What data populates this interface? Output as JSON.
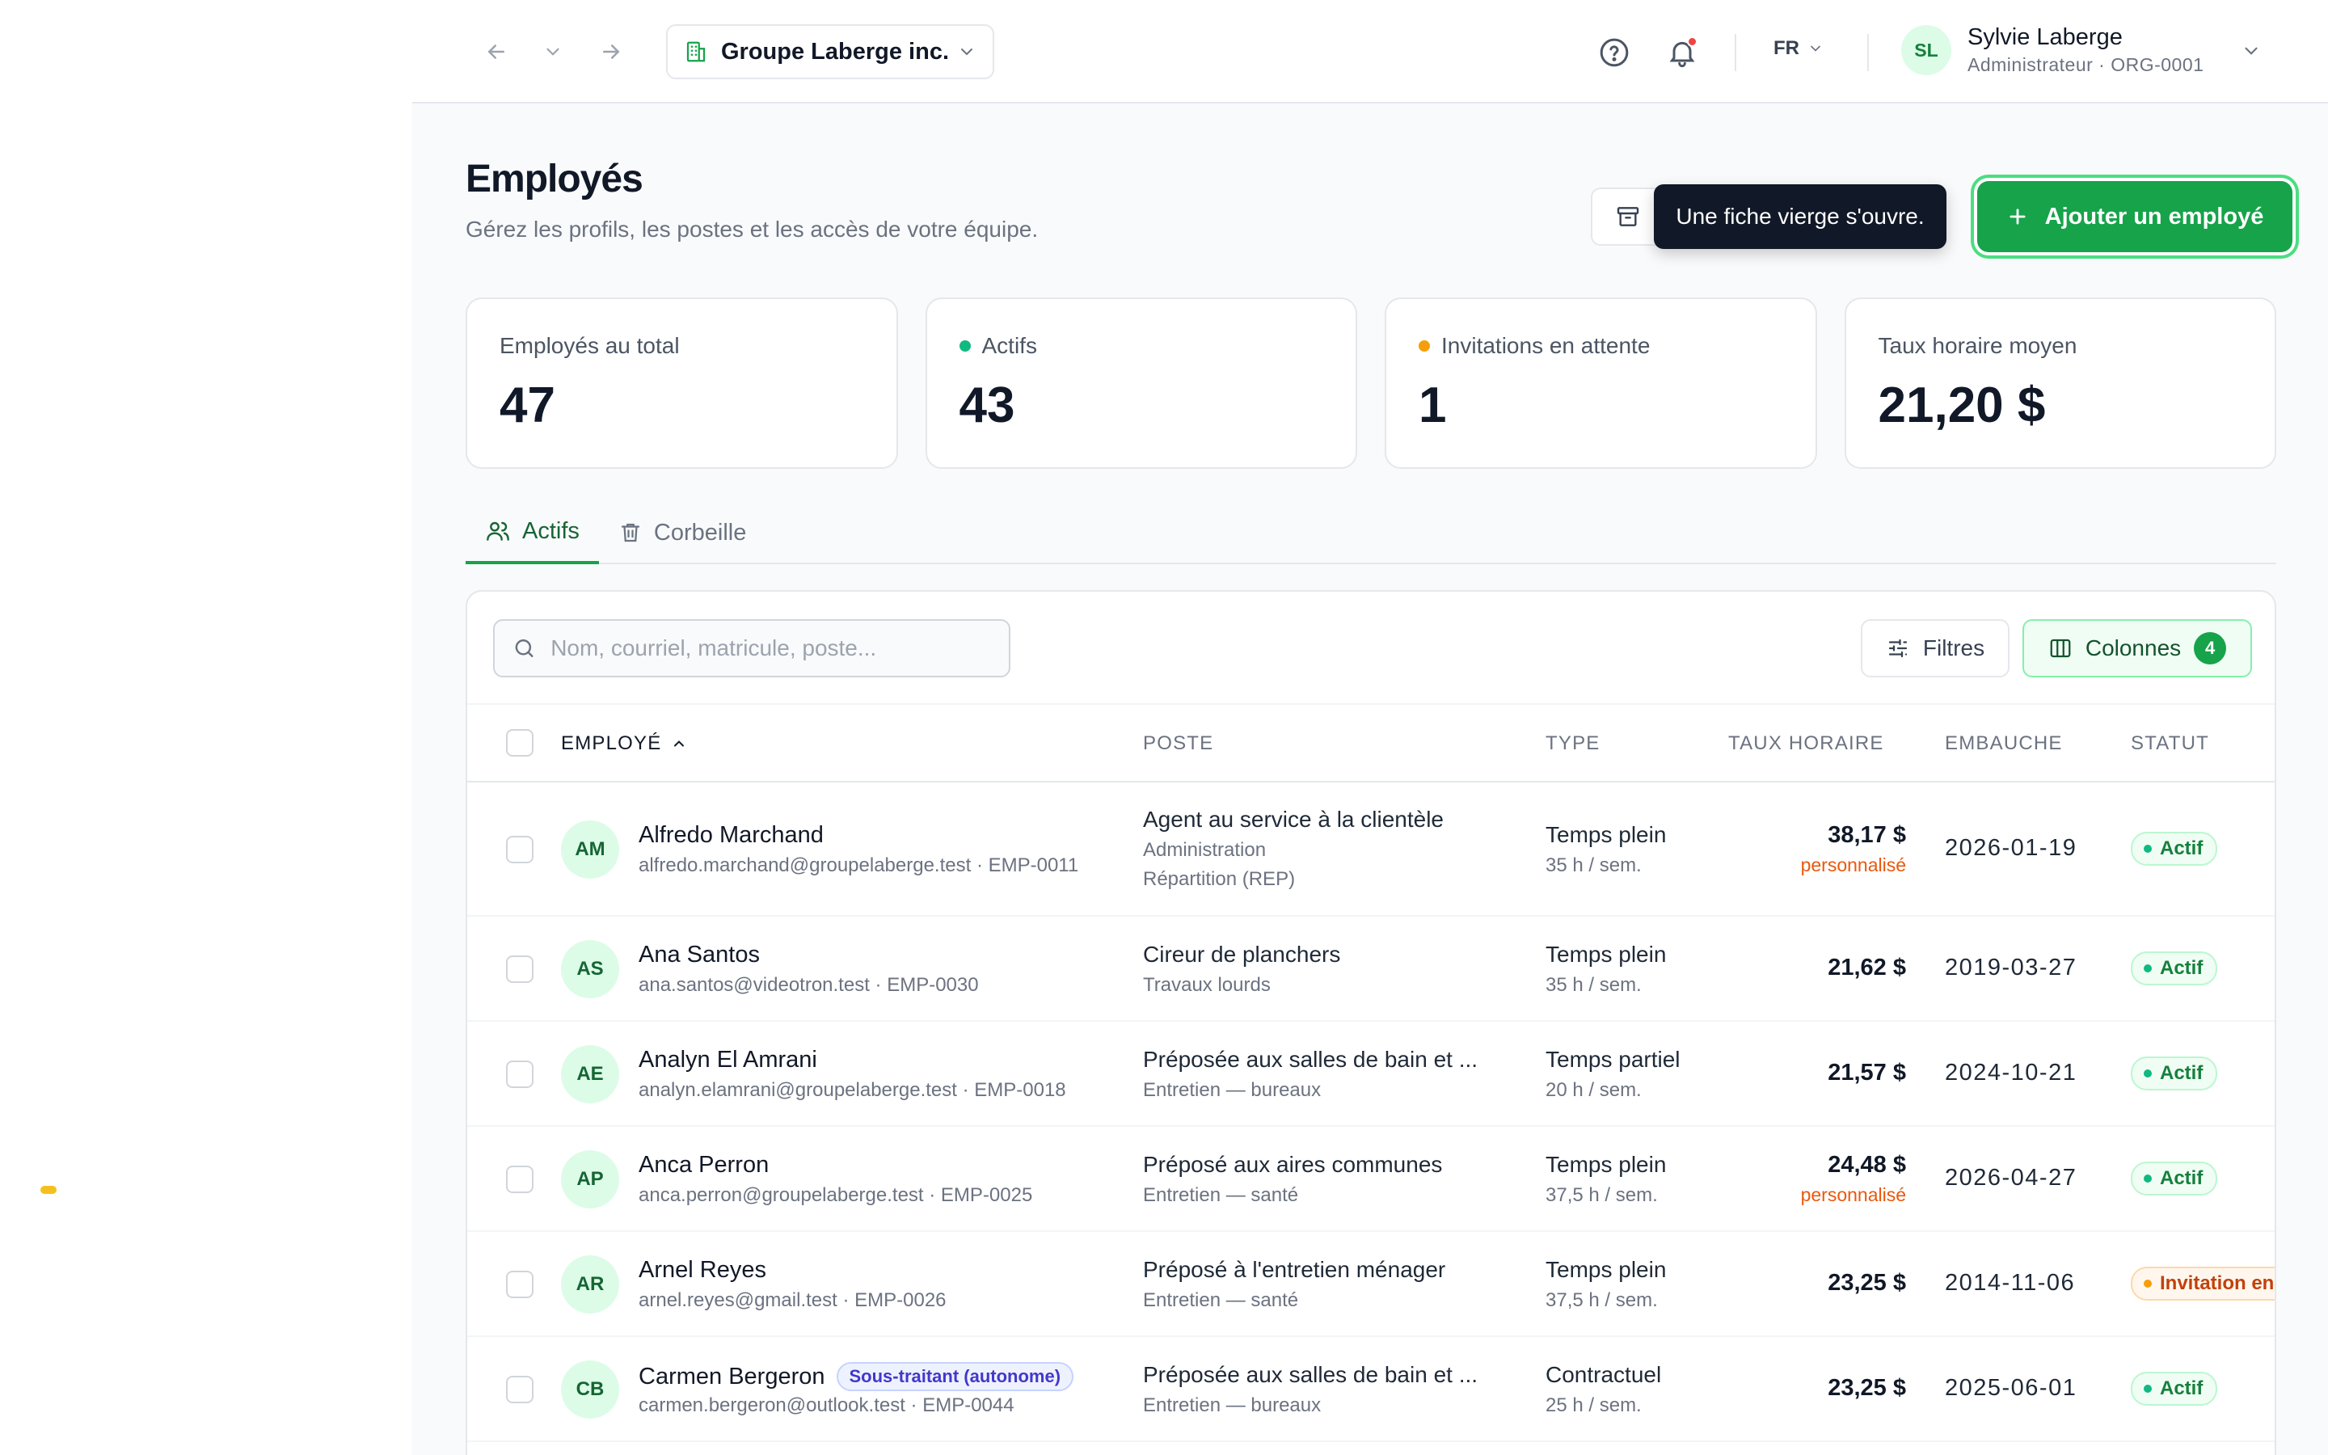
{
  "colors": {
    "accent": "#16a34a",
    "active": "#10b981",
    "pending": "#f59e0b",
    "notif": "#ef4444"
  },
  "topbar": {
    "org_name": "Groupe Laberge inc.",
    "lang": "FR",
    "user": {
      "initials": "SL",
      "name": "Sylvie Laberge",
      "role": "Administrateur · ORG-0001"
    }
  },
  "header": {
    "title": "Employés",
    "subtitle": "Gérez les profils, les postes et les accès de votre équipe.",
    "tooltip": "Une fiche vierge s'ouvre.",
    "add_label": "Ajouter un employé"
  },
  "stats": [
    {
      "label": "Employés au total",
      "value": "47"
    },
    {
      "label": "Actifs",
      "value": "43"
    },
    {
      "label": "Invitations en attente",
      "value": "1"
    },
    {
      "label": "Taux horaire moyen",
      "value": "21,20 $"
    }
  ],
  "tabs": [
    {
      "label": "Actifs",
      "active": true
    },
    {
      "label": "Corbeille",
      "active": false
    }
  ],
  "toolbar": {
    "search_placeholder": "Nom, courriel, matricule, poste...",
    "filters_label": "Filtres",
    "columns_label": "Colonnes",
    "columns_count": "4"
  },
  "columns": {
    "employee": "EMPLOYÉ",
    "position": "POSTE",
    "type": "TYPE",
    "rate": "TAUX HORAIRE",
    "hire": "EMBAUCHE",
    "status": "STATUT"
  },
  "rows": [
    {
      "initials": "AM",
      "name": "Alfredo Marchand",
      "badge": "",
      "meta": "alfredo.marchand@groupelaberge.test · EMP-0011",
      "position": "Agent au service à la clientèle",
      "position_sub": "Administration",
      "position_sub2": "Répartition (REP)",
      "type": "Temps plein",
      "hours": "35 h / sem.",
      "rate": "38,17 $",
      "rate_note": "personnalisé",
      "hire": "2026-01-19",
      "status": "Actif",
      "status_kind": "active"
    },
    {
      "initials": "AS",
      "name": "Ana Santos",
      "badge": "",
      "meta": "ana.santos@videotron.test · EMP-0030",
      "position": "Cireur de planchers",
      "position_sub": "Travaux lourds",
      "position_sub2": "",
      "type": "Temps plein",
      "hours": "35 h / sem.",
      "rate": "21,62 $",
      "rate_note": "",
      "hire": "2019-03-27",
      "status": "Actif",
      "status_kind": "active"
    },
    {
      "initials": "AE",
      "name": "Analyn El Amrani",
      "badge": "",
      "meta": "analyn.elamrani@groupelaberge.test · EMP-0018",
      "position": "Préposée aux salles de bain et ...",
      "position_sub": "Entretien — bureaux",
      "position_sub2": "",
      "type": "Temps partiel",
      "hours": "20 h / sem.",
      "rate": "21,57 $",
      "rate_note": "",
      "hire": "2024-10-21",
      "status": "Actif",
      "status_kind": "active"
    },
    {
      "initials": "AP",
      "name": "Anca Perron",
      "badge": "",
      "meta": "anca.perron@groupelaberge.test · EMP-0025",
      "position": "Préposé aux aires communes",
      "position_sub": "Entretien — santé",
      "position_sub2": "",
      "type": "Temps plein",
      "hours": "37,5 h / sem.",
      "rate": "24,48 $",
      "rate_note": "personnalisé",
      "hire": "2026-04-27",
      "status": "Actif",
      "status_kind": "active"
    },
    {
      "initials": "AR",
      "name": "Arnel Reyes",
      "badge": "",
      "meta": "arnel.reyes@gmail.test · EMP-0026",
      "position": "Préposé à l'entretien ménager",
      "position_sub": "Entretien — santé",
      "position_sub2": "",
      "type": "Temps plein",
      "hours": "37,5 h / sem.",
      "rate": "23,25 $",
      "rate_note": "",
      "hire": "2014-11-06",
      "status": "Invitation en attente",
      "status_kind": "pending"
    },
    {
      "initials": "CB",
      "name": "Carmen Bergeron",
      "badge": "Sous-traitant (autonome)",
      "meta": "carmen.bergeron@outlook.test · EMP-0044",
      "position": "Préposée aux salles de bain et ...",
      "position_sub": "Entretien — bureaux",
      "position_sub2": "",
      "type": "Contractuel",
      "hours": "25 h / sem.",
      "rate": "23,25 $",
      "rate_note": "",
      "hire": "2025-06-01",
      "status": "Actif",
      "status_kind": "active"
    }
  ]
}
